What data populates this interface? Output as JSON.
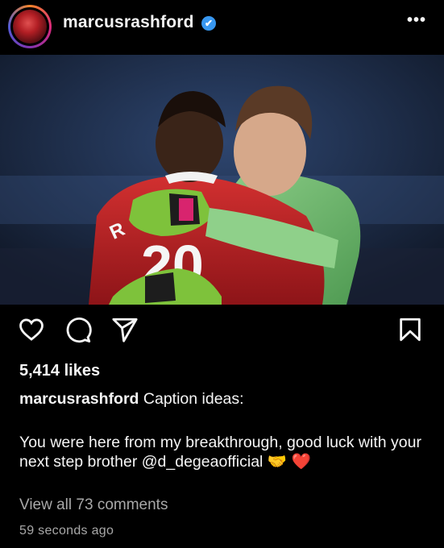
{
  "header": {
    "username": "marcusrashford",
    "verified_glyph": "✔",
    "more_icon": "more-options-icon",
    "more_glyph": "•••"
  },
  "post": {
    "likes": "5,414 likes",
    "caption_user": "marcusrashford",
    "caption_lead": "Caption ideas:",
    "caption_body": "You were here from my breakthrough, good luck with your next step brother @d_degeaofficial",
    "caption_emojis": "🤝 ❤️",
    "view_comments": "View all 73 comments",
    "timestamp": "59 seconds ago"
  },
  "actions": [
    "heart-icon",
    "comment-icon",
    "share-icon",
    "bookmark-icon"
  ],
  "colors": {
    "background": "#000000",
    "text": "#f5f5f5",
    "muted": "#a8a8a8",
    "verified": "#3897f0"
  }
}
